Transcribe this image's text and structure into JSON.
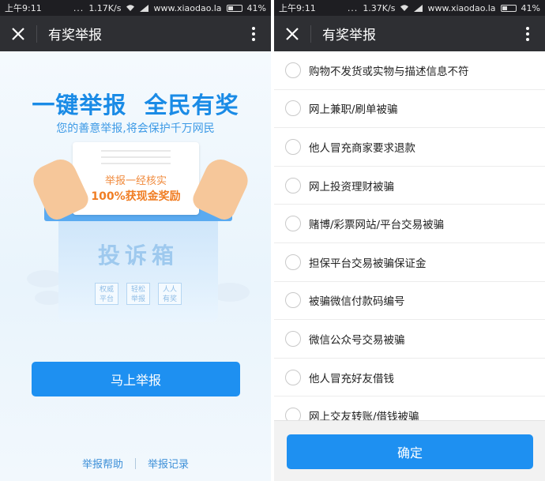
{
  "status_left": {
    "time": "上午9:11",
    "dots": "...",
    "speed": "1.17K/s",
    "domain": "www.xiaodao.la",
    "battery": "41%"
  },
  "status_right": {
    "time": "上午9:11",
    "dots": "...",
    "speed": "1.37K/s",
    "domain": "www.xiaodao.la",
    "battery": "41%"
  },
  "nav": {
    "close_icon": "close-icon",
    "title": "有奖举报",
    "more_icon": "more-vertical-icon"
  },
  "landing": {
    "headline": "一键举报  全民有奖",
    "subheadline": "您的善意举报,将会保护千万网民",
    "paper_line1": "举报一经核实",
    "paper_line2": "100%获现金奖励",
    "box_label": "投诉箱",
    "badges": [
      "权威\n平台",
      "轻松\n举报",
      "人人\n有奖"
    ],
    "report_button": "马上举报",
    "help_link": "举报帮助",
    "history_link": "举报记录"
  },
  "reasons": {
    "items": [
      "购物不发货或实物与描述信息不符",
      "网上兼职/刷单被骗",
      "他人冒充商家要求退款",
      "网上投资理财被骗",
      "赌博/彩票网站/平台交易被骗",
      "担保平台交易被骗保证金",
      "被骗微信付款码编号",
      "微信公众号交易被骗",
      "他人冒充好友借钱",
      "网上交友转账/借钱被骗"
    ],
    "confirm_button": "确定"
  },
  "colors": {
    "accent": "#1e90f1",
    "nav_bg": "#2e2f33",
    "status_bg": "#1e1e22",
    "highlight_orange": "#f07d23"
  }
}
